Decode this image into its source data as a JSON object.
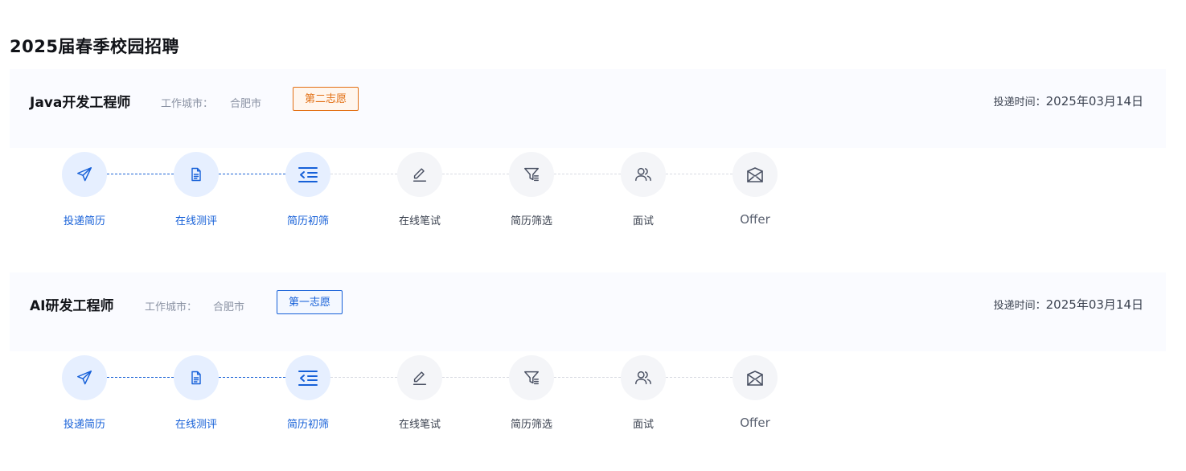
{
  "page": {
    "title": "2025届春季校园招聘"
  },
  "colors": {
    "active": "#1660d8",
    "inactive_icon": "#4a5163",
    "active_circle": "#e6efff",
    "inactive_circle": "#f4f5f8",
    "card_header": "#fafbff",
    "orange": "#e26f13",
    "blue": "#1660d8"
  },
  "jobs": [
    {
      "title": "Java开发工程师",
      "city_label": "工作城市：",
      "city": "合肥市",
      "choice": "第二志愿",
      "choice_color": "orange",
      "submit_label": "投递时间：",
      "submit_time": "2025年03月14日",
      "steps": [
        {
          "label": "投递简历",
          "icon": "send-icon",
          "active": true
        },
        {
          "label": "在线测评",
          "icon": "document-icon",
          "active": true
        },
        {
          "label": "简历初筛",
          "icon": "list-indent-icon",
          "active": true
        },
        {
          "label": "在线笔试",
          "icon": "pen-icon",
          "active": false
        },
        {
          "label": "简历筛选",
          "icon": "filter-icon",
          "active": false
        },
        {
          "label": "面试",
          "icon": "users-icon",
          "active": false
        },
        {
          "label": "Offer",
          "icon": "mail-icon",
          "active": false
        }
      ]
    },
    {
      "title": "AI研发工程师",
      "city_label": "工作城市：",
      "city": "合肥市",
      "choice": "第一志愿",
      "choice_color": "blue",
      "submit_label": "投递时间：",
      "submit_time": "2025年03月14日",
      "steps": [
        {
          "label": "投递简历",
          "icon": "send-icon",
          "active": true
        },
        {
          "label": "在线测评",
          "icon": "document-icon",
          "active": true
        },
        {
          "label": "简历初筛",
          "icon": "list-indent-icon",
          "active": true
        },
        {
          "label": "在线笔试",
          "icon": "pen-icon",
          "active": false
        },
        {
          "label": "简历筛选",
          "icon": "filter-icon",
          "active": false
        },
        {
          "label": "面试",
          "icon": "users-icon",
          "active": false
        },
        {
          "label": "Offer",
          "icon": "mail-icon",
          "active": false
        }
      ]
    }
  ]
}
